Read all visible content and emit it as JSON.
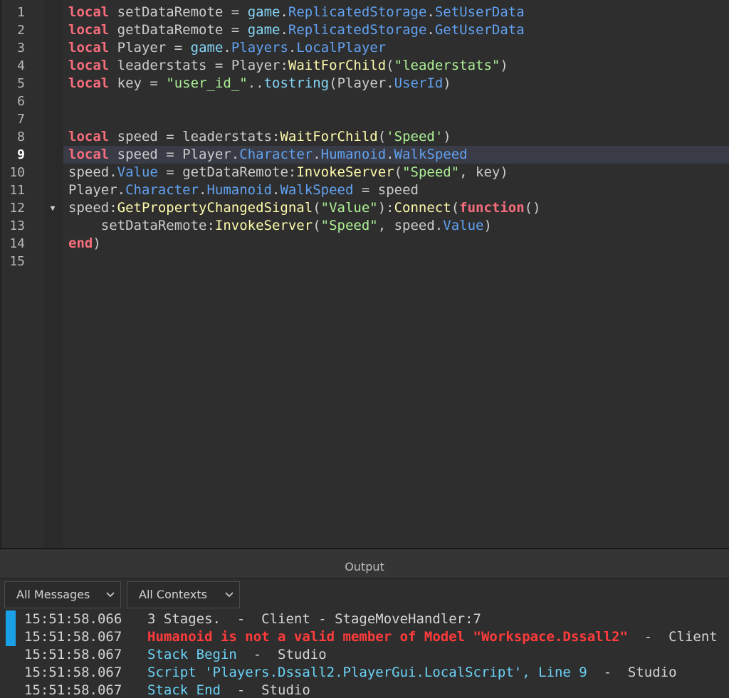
{
  "editor": {
    "current_line": 9,
    "lines": [
      {
        "n": "1",
        "tokens": [
          [
            "kw",
            "local"
          ],
          [
            "id",
            " setDataRemote "
          ],
          [
            "op",
            "="
          ],
          [
            "id",
            " "
          ],
          [
            "bi",
            "game"
          ],
          [
            "op",
            "."
          ],
          [
            "prop",
            "ReplicatedStorage"
          ],
          [
            "op",
            "."
          ],
          [
            "prop",
            "SetUserData"
          ]
        ]
      },
      {
        "n": "2",
        "tokens": [
          [
            "kw",
            "local"
          ],
          [
            "id",
            " getDataRemote "
          ],
          [
            "op",
            "="
          ],
          [
            "id",
            " "
          ],
          [
            "bi",
            "game"
          ],
          [
            "op",
            "."
          ],
          [
            "prop",
            "ReplicatedStorage"
          ],
          [
            "op",
            "."
          ],
          [
            "prop",
            "GetUserData"
          ]
        ]
      },
      {
        "n": "3",
        "tokens": [
          [
            "kw",
            "local"
          ],
          [
            "id",
            " Player "
          ],
          [
            "op",
            "="
          ],
          [
            "id",
            " "
          ],
          [
            "bi",
            "game"
          ],
          [
            "op",
            "."
          ],
          [
            "prop",
            "Players"
          ],
          [
            "op",
            "."
          ],
          [
            "prop",
            "LocalPlayer"
          ]
        ]
      },
      {
        "n": "4",
        "tokens": [
          [
            "kw",
            "local"
          ],
          [
            "id",
            " leaderstats "
          ],
          [
            "op",
            "="
          ],
          [
            "id",
            " Player:"
          ],
          [
            "fn",
            "WaitForChild"
          ],
          [
            "op",
            "("
          ],
          [
            "str",
            "\"leaderstats\""
          ],
          [
            "op",
            ")"
          ]
        ]
      },
      {
        "n": "5",
        "tokens": [
          [
            "kw",
            "local"
          ],
          [
            "id",
            " key "
          ],
          [
            "op",
            "="
          ],
          [
            "id",
            " "
          ],
          [
            "str",
            "\"user_id_\""
          ],
          [
            "op",
            ".."
          ],
          [
            "bi",
            "tostring"
          ],
          [
            "op",
            "("
          ],
          [
            "id",
            "Player."
          ],
          [
            "prop",
            "UserId"
          ],
          [
            "op",
            ")"
          ]
        ]
      },
      {
        "n": "6",
        "tokens": []
      },
      {
        "n": "7",
        "tokens": []
      },
      {
        "n": "8",
        "tokens": [
          [
            "kw",
            "local"
          ],
          [
            "id",
            " speed "
          ],
          [
            "op",
            "="
          ],
          [
            "id",
            " leaderstats:"
          ],
          [
            "fn",
            "WaitForChild"
          ],
          [
            "op",
            "("
          ],
          [
            "str",
            "'Speed'"
          ],
          [
            "op",
            ")"
          ]
        ]
      },
      {
        "n": "9",
        "tokens": [
          [
            "kw",
            "local"
          ],
          [
            "id",
            " speed "
          ],
          [
            "op",
            "="
          ],
          [
            "id",
            " Player."
          ],
          [
            "prop",
            "Character"
          ],
          [
            "op",
            "."
          ],
          [
            "prop",
            "Humanoid"
          ],
          [
            "op",
            "."
          ],
          [
            "prop",
            "WalkSpeed"
          ]
        ]
      },
      {
        "n": "10",
        "tokens": [
          [
            "id",
            "speed."
          ],
          [
            "prop",
            "Value"
          ],
          [
            "id",
            " "
          ],
          [
            "op",
            "="
          ],
          [
            "id",
            " getDataRemote:"
          ],
          [
            "fn",
            "InvokeServer"
          ],
          [
            "op",
            "("
          ],
          [
            "str",
            "\"Speed\""
          ],
          [
            "op",
            ","
          ],
          [
            "id",
            " key"
          ],
          [
            "op",
            ")"
          ]
        ]
      },
      {
        "n": "11",
        "tokens": [
          [
            "id",
            "Player."
          ],
          [
            "prop",
            "Character"
          ],
          [
            "op",
            "."
          ],
          [
            "prop",
            "Humanoid"
          ],
          [
            "op",
            "."
          ],
          [
            "prop",
            "WalkSpeed"
          ],
          [
            "id",
            " "
          ],
          [
            "op",
            "="
          ],
          [
            "id",
            " speed"
          ]
        ]
      },
      {
        "n": "12",
        "fold": "▼",
        "tokens": [
          [
            "id",
            "speed:"
          ],
          [
            "fn",
            "GetPropertyChangedSignal"
          ],
          [
            "op",
            "("
          ],
          [
            "str",
            "\"Value\""
          ],
          [
            "op",
            "):"
          ],
          [
            "fn",
            "Connect"
          ],
          [
            "op",
            "("
          ],
          [
            "kw",
            "function"
          ],
          [
            "op",
            "()"
          ]
        ]
      },
      {
        "n": "13",
        "tokens": [
          [
            "id",
            "    setDataRemote:"
          ],
          [
            "fn",
            "InvokeServer"
          ],
          [
            "op",
            "("
          ],
          [
            "str",
            "\"Speed\""
          ],
          [
            "op",
            ","
          ],
          [
            "id",
            " speed."
          ],
          [
            "prop",
            "Value"
          ],
          [
            "op",
            ")"
          ]
        ]
      },
      {
        "n": "14",
        "tokens": [
          [
            "kw",
            "end"
          ],
          [
            "op",
            ")"
          ]
        ]
      },
      {
        "n": "15",
        "tokens": []
      }
    ]
  },
  "output": {
    "title": "Output",
    "message_filter": "All Messages",
    "context_filter": "All Contexts",
    "logs": [
      {
        "time": "15:51:58.066",
        "kind": "normal",
        "text": "3 Stages.  -  Client - StageMoveHandler:7"
      },
      {
        "time": "15:51:58.067",
        "kind": "error",
        "text": "Humanoid is not a valid member of Model \"Workspace.Dssall2\"",
        "tail": "  -  Client"
      },
      {
        "time": "15:51:58.067",
        "kind": "info",
        "text": "Stack Begin",
        "tail": "  -  Studio"
      },
      {
        "time": "15:51:58.067",
        "kind": "info",
        "text": "Script 'Players.Dssall2.PlayerGui.LocalScript', Line 9",
        "tail": "  -  Studio"
      },
      {
        "time": "15:51:58.067",
        "kind": "info",
        "text": "Stack End",
        "tail": "  -  Studio"
      }
    ]
  },
  "colors": {
    "keyword": "#f86d7c",
    "property": "#61a1f1",
    "method": "#fdfbac",
    "string": "#adf195",
    "builtin": "#84d6f7",
    "error": "#ff3b3b",
    "marker": "#1aa0e6"
  },
  "icons": {
    "fold": "chevron-down-icon",
    "dropdown": "chevron-down-icon"
  }
}
